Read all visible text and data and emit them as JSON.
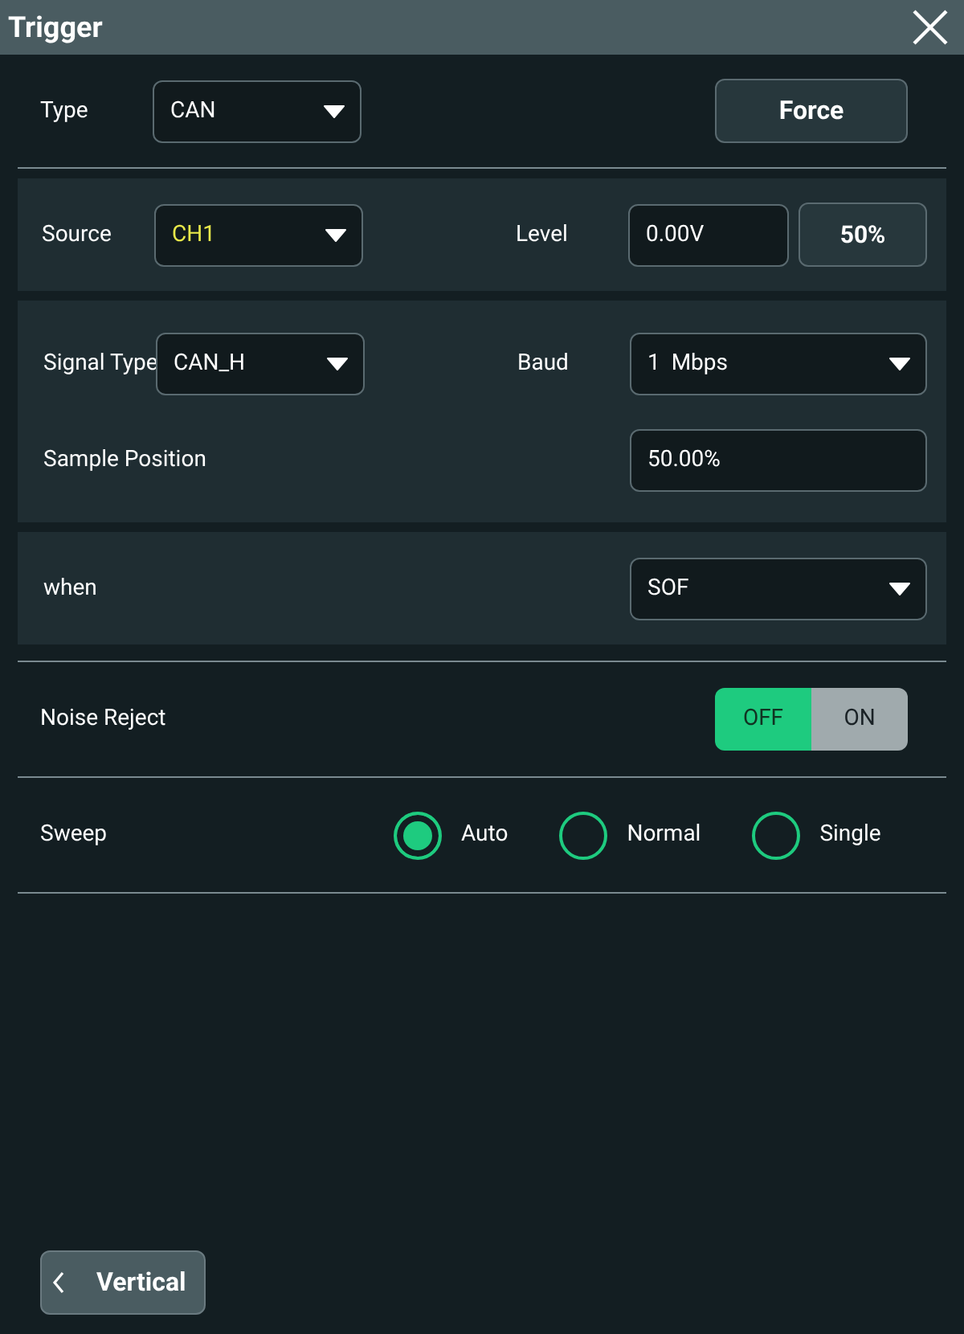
{
  "window": {
    "title": "Trigger"
  },
  "type": {
    "label": "Type",
    "value": "CAN"
  },
  "force_button": "Force",
  "source": {
    "label": "Source",
    "value": "CH1"
  },
  "level": {
    "label": "Level",
    "value": "0.00V",
    "button": "50%"
  },
  "signal_type": {
    "label": "Signal Type",
    "value": "CAN_H"
  },
  "baud": {
    "label": "Baud",
    "value": "1  Mbps"
  },
  "sample_position": {
    "label": "Sample Position",
    "value": "50.00%"
  },
  "when": {
    "label": "when",
    "value": "SOF"
  },
  "noise_reject": {
    "label": "Noise Reject",
    "options": [
      {
        "label": "OFF",
        "selected": true
      },
      {
        "label": "ON",
        "selected": false
      }
    ]
  },
  "sweep": {
    "label": "Sweep",
    "options": [
      {
        "label": "Auto",
        "selected": true
      },
      {
        "label": "Normal",
        "selected": false
      },
      {
        "label": "Single",
        "selected": false
      }
    ]
  },
  "back_button": "Vertical"
}
